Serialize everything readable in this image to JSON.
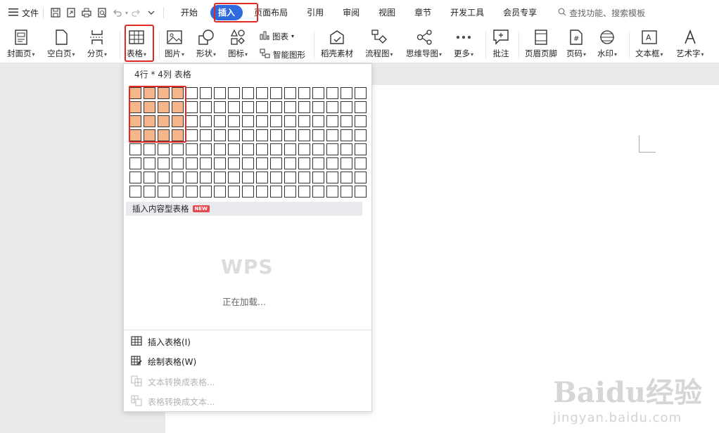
{
  "menubar": {
    "file_label": "文件",
    "tabs": [
      "开始",
      "插入",
      "页面布局",
      "引用",
      "审阅",
      "视图",
      "章节",
      "开发工具",
      "会员专享"
    ],
    "active_tab": "插入",
    "search_placeholder": "查找功能、搜索模板"
  },
  "ribbon": {
    "cover_page": "封面页",
    "blank_page": "空白页",
    "page_break": "分页",
    "table": "表格",
    "picture": "图片",
    "shape": "形状",
    "icon": "图标",
    "chart": "图表",
    "smart_graphic": "智能图形",
    "daoke_material": "稻壳素材",
    "flowchart": "流程图",
    "mindmap": "思维导图",
    "more": "更多",
    "comment": "批注",
    "header_footer": "页眉页脚",
    "page_number": "页码",
    "watermark": "水印",
    "textbox": "文本框",
    "wordart": "艺术字"
  },
  "dropdown": {
    "title": "4行 * 4列 表格",
    "grid_rows": 8,
    "grid_cols": 17,
    "selected_rows": 4,
    "selected_cols": 4,
    "content_table_label": "插入内容型表格",
    "new_badge": "NEW",
    "logo_text": "WPS",
    "loading_text": "正在加载...",
    "menu_items": [
      {
        "label": "插入表格(I)",
        "enabled": true
      },
      {
        "label": "绘制表格(W)",
        "enabled": true
      },
      {
        "label": "文本转换成表格...",
        "enabled": false
      },
      {
        "label": "表格转换成文本...",
        "enabled": false
      }
    ]
  },
  "watermark": {
    "brand": "Baidu经验",
    "url": "jingyan.baidu.com"
  },
  "colors": {
    "accent": "#2f6bdc",
    "highlight": "#e02a24",
    "selected_cell": "#f6b58a"
  }
}
